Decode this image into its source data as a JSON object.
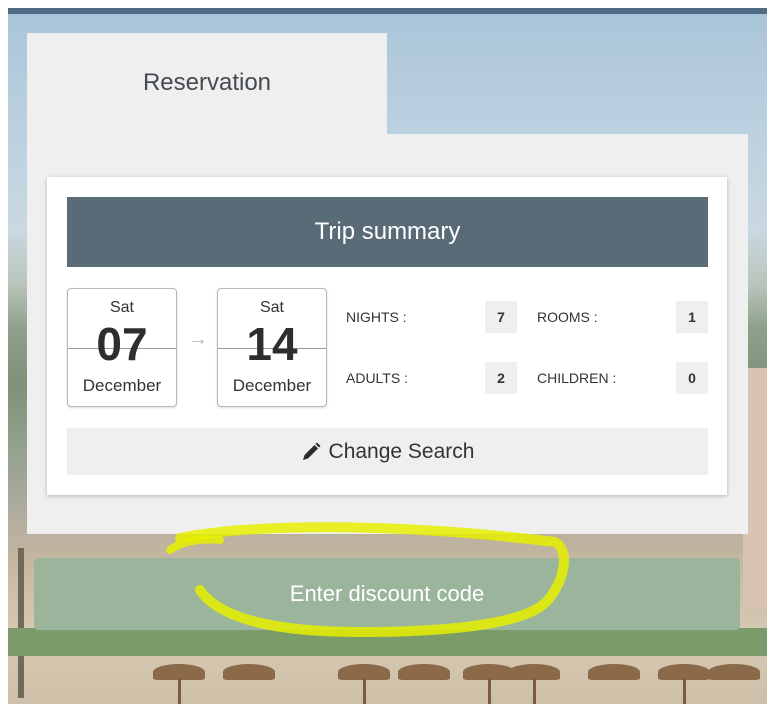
{
  "reservation": {
    "tab_label": "Reservation"
  },
  "summary": {
    "title": "Trip summary",
    "check_in": {
      "dow": "Sat",
      "day": "07",
      "month": "December"
    },
    "check_out": {
      "dow": "Sat",
      "day": "14",
      "month": "December"
    },
    "nights_label": "NIGHTS :",
    "nights_value": "7",
    "rooms_label": "ROOMS :",
    "rooms_value": "1",
    "adults_label": "ADULTS :",
    "adults_value": "2",
    "children_label": "CHILDREN :",
    "children_value": "0",
    "change_search_label": "Change Search"
  },
  "discount": {
    "button_label": "Enter discount code"
  },
  "colors": {
    "header_bg": "#5a6b78",
    "discount_bg": "#9bb59c",
    "highlight": "#e6ef00"
  },
  "icons": {
    "arrow": "arrow-right-icon",
    "pencil": "pencil-icon"
  }
}
